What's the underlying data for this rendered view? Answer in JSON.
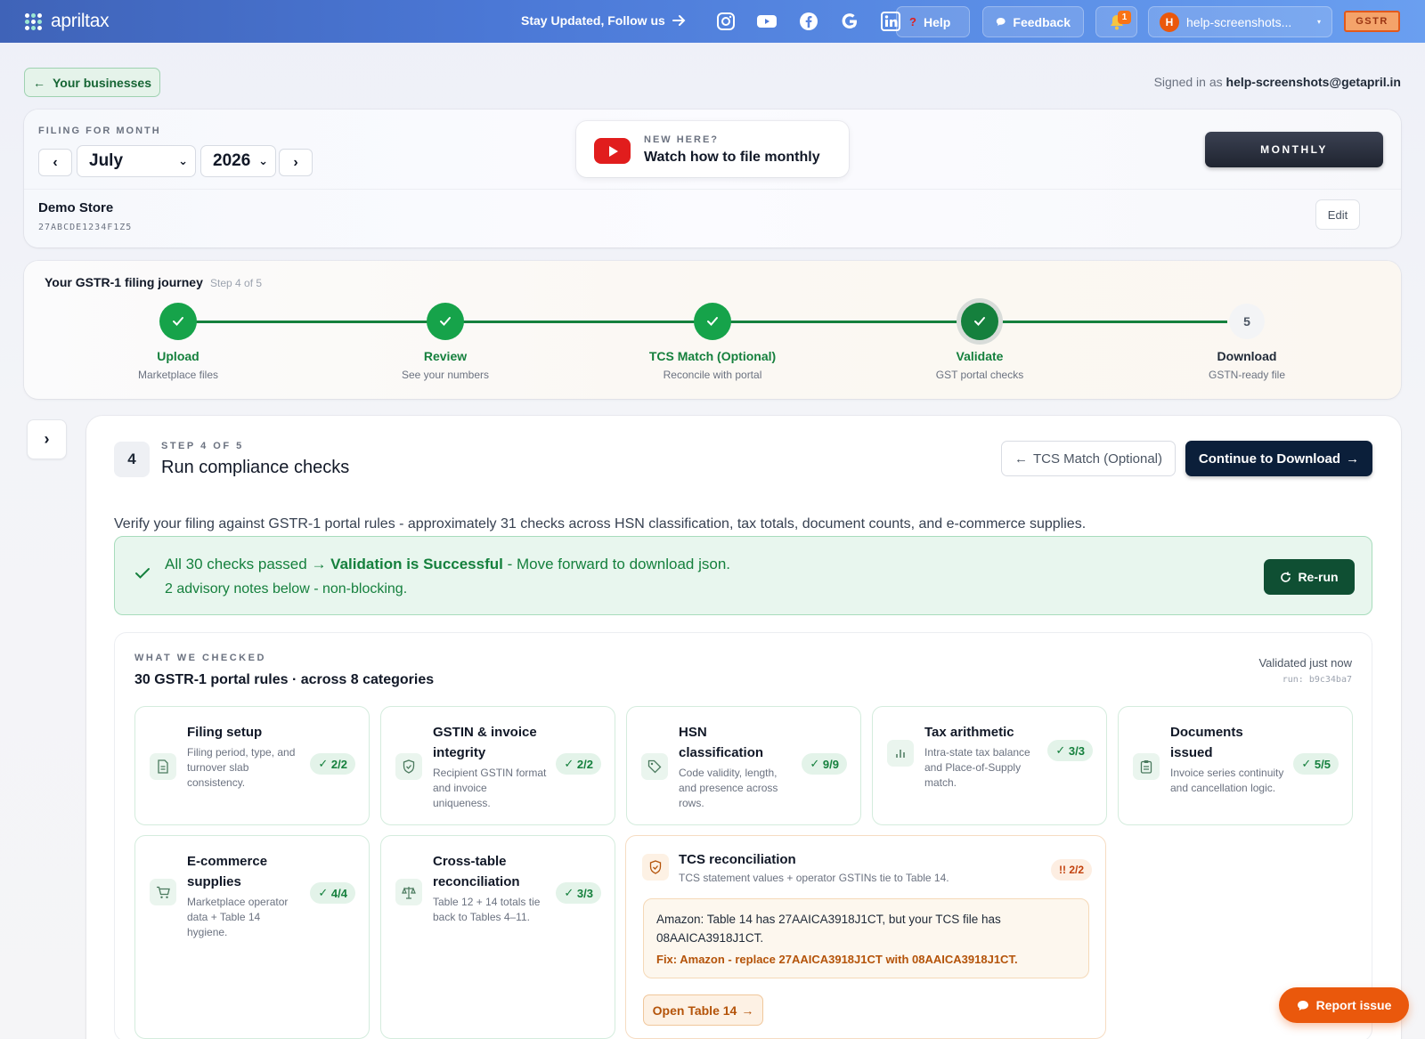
{
  "topbar": {
    "brand": "apriltax",
    "follow_text": "Stay Updated, Follow us",
    "help_label": "Help",
    "feedback_label": "Feedback",
    "notification_count": "1",
    "user_initial": "H",
    "user_label": "help-screenshots...",
    "gstr_label": "GSTR",
    "social_icons": [
      "instagram-icon",
      "youtube-icon",
      "facebook-icon",
      "google-icon",
      "linkedin-icon"
    ]
  },
  "subheader": {
    "back_label": "Your businesses",
    "signed_prefix": "Signed in as",
    "signed_email": "help-screenshots@getapril.in"
  },
  "filing": {
    "caption": "FILING FOR MONTH",
    "month": "July",
    "year": "2026",
    "video_caption": "NEW HERE?",
    "video_title": "Watch how to file monthly",
    "frequency": "MONTHLY",
    "store_name": "Demo Store",
    "gstin": "27ABCDE1234F1Z5",
    "edit_label": "Edit"
  },
  "journey": {
    "title": "Your GSTR-1 filing journey",
    "step_note": "Step 4 of 5",
    "steps": [
      {
        "label": "Upload",
        "sub": "Marketplace files",
        "status": "done"
      },
      {
        "label": "Review",
        "sub": "See your numbers",
        "status": "done"
      },
      {
        "label": "TCS Match (Optional)",
        "sub": "Reconcile with portal",
        "status": "done"
      },
      {
        "label": "Validate",
        "sub": "GST portal checks",
        "status": "active"
      },
      {
        "label": "Download",
        "sub": "GSTN-ready file",
        "status": "pending",
        "number": "5"
      }
    ]
  },
  "main": {
    "step_number": "4",
    "step_caption": "STEP 4 OF 5",
    "title": "Run compliance checks",
    "back_button": "TCS Match (Optional)",
    "continue_button": "Continue to Download",
    "description": "Verify your filing against GSTR-1 portal rules - approximately 31 checks across HSN classification, tax totals, document counts, and e-commerce supplies.",
    "success_part1": "All 30 checks passed",
    "success_part2": "Validation is Successful",
    "success_part3": "- Move forward to download json.",
    "advisory": "2 advisory notes below - non-blocking.",
    "rerun_label": "Re-run"
  },
  "checked": {
    "caption": "WHAT WE CHECKED",
    "title": "30 GSTR-1 portal rules · across 8 categories",
    "validated": "Validated just now",
    "run_id": "run: b9c34ba7",
    "categories": [
      {
        "title": "Filing setup",
        "desc": "Filing period, type, and turnover slab consistency.",
        "count": "2/2",
        "icon": "document-icon"
      },
      {
        "title": "GSTIN & invoice integrity",
        "desc": "Recipient GSTIN format and invoice uniqueness.",
        "count": "2/2",
        "icon": "shield-icon"
      },
      {
        "title": "HSN classification",
        "desc": "Code validity, length, and presence across rows.",
        "count": "9/9",
        "icon": "tag-icon"
      },
      {
        "title": "Tax arithmetic",
        "desc": "Intra-state tax balance and Place-of-Supply match.",
        "count": "3/3",
        "icon": "bar-chart-icon"
      },
      {
        "title": "Documents issued",
        "desc": "Invoice series continuity and cancellation logic.",
        "count": "5/5",
        "icon": "clipboard-icon"
      },
      {
        "title": "E-commerce supplies",
        "desc": "Marketplace operator data + Table 14 hygiene.",
        "count": "4/4",
        "icon": "cart-icon"
      },
      {
        "title": "Cross-table reconciliation",
        "desc": "Table 12 + 14 totals tie back to Tables 4–11.",
        "count": "3/3",
        "icon": "scale-icon"
      }
    ],
    "tcs": {
      "title": "TCS reconciliation",
      "desc": "TCS statement values + operator GSTINs tie to Table 14.",
      "count": "2/2",
      "message": "Amazon: Table 14 has 27AAICA3918J1CT, but your TCS file has 08AAICA3918J1CT.",
      "fix": "Fix: Amazon - replace 27AAICA3918J1CT with 08AAICA3918J1CT.",
      "open_label": "Open Table 14"
    }
  },
  "report_label": "Report issue"
}
